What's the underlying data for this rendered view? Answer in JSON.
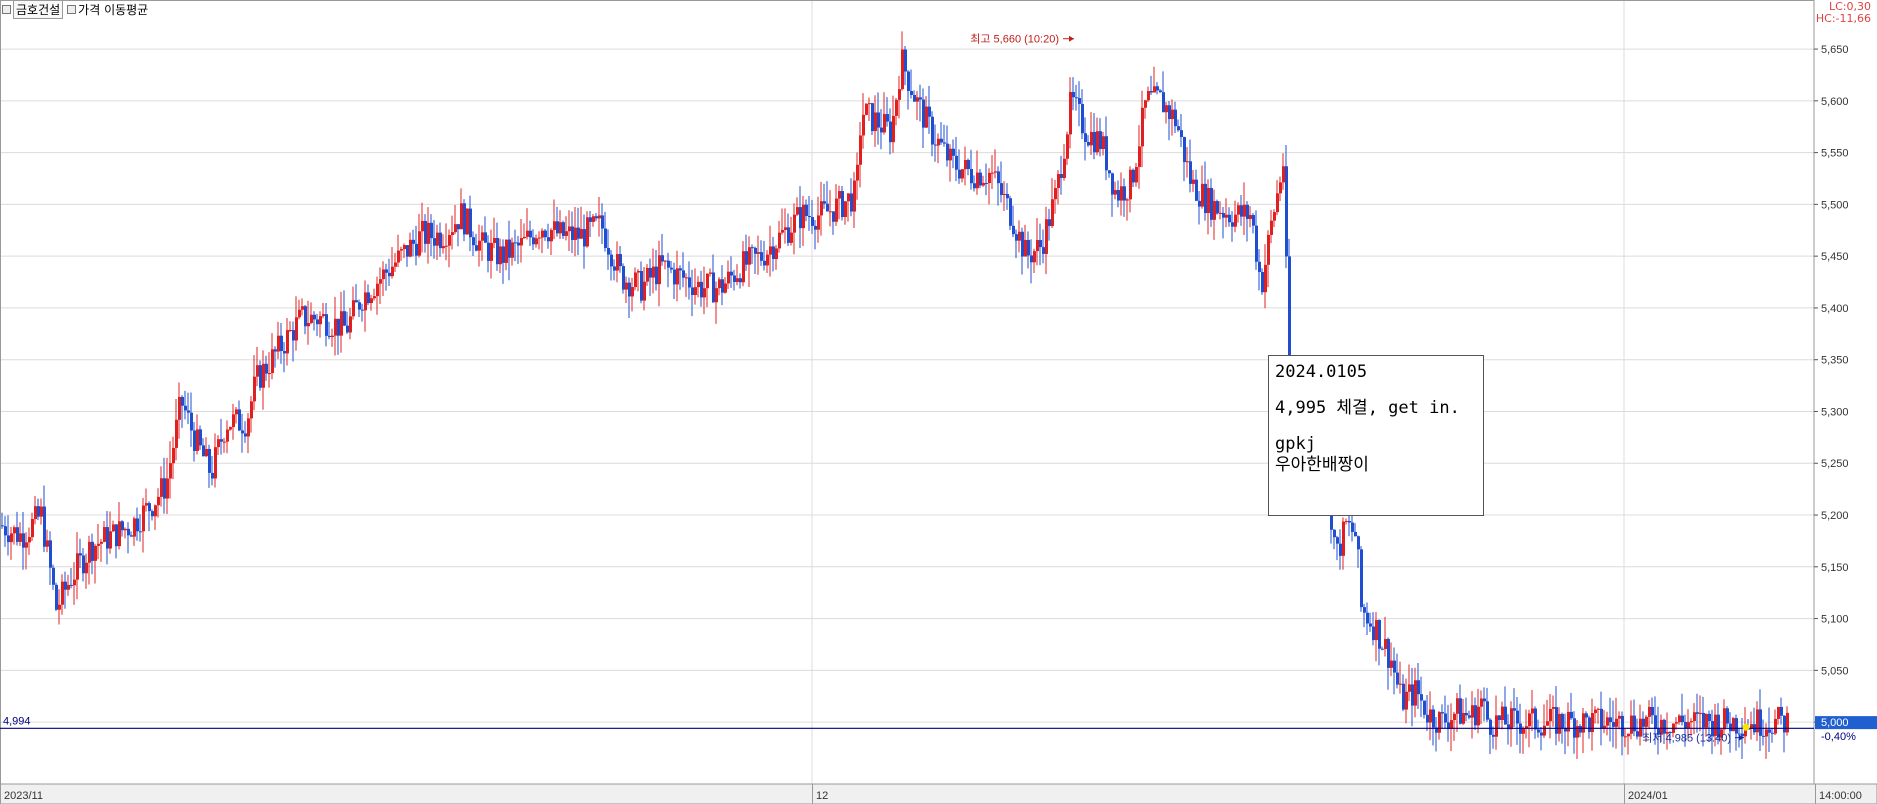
{
  "header": {
    "stock_name": "금호건설",
    "indicator_label": "가격 이동평균",
    "lc_label": "LC:0,30",
    "hc_label": "HC:-11,66"
  },
  "note": {
    "line1": "2024.0105",
    "line2": "4,995 체결, get in.",
    "line3": "gpkj",
    "line4": "우아한배짱이"
  },
  "colors": {
    "up": "#e02020",
    "down": "#1f4fd0",
    "baseline": "#000080",
    "grid": "#dcdcdc"
  },
  "chart_data": {
    "type": "bar",
    "subtype": "intraday price chart (up/down ticks)",
    "ylim": [
      4975,
      5680
    ],
    "y_ticks": [
      "5,000",
      "5,050",
      "5,100",
      "5,150",
      "5,200",
      "5,250",
      "5,300",
      "5,350",
      "5,400",
      "5,450",
      "5,500",
      "5,550",
      "5,600",
      "5,650"
    ],
    "y_tick_values": [
      5000,
      5050,
      5100,
      5150,
      5200,
      5250,
      5300,
      5350,
      5400,
      5450,
      5500,
      5550,
      5600,
      5650
    ],
    "x_ticks": [
      "2023/11",
      "12",
      "2024/01",
      "14:00:00"
    ],
    "high": {
      "value": 5660,
      "label": "최고 5,660 (10:20)"
    },
    "low": {
      "value": 4985,
      "label": "최저 4,985 (13:40)"
    },
    "left_value_label": "4,994",
    "current_price_label": "5,000",
    "change_label": "-0,40%",
    "baseline_value": 4994,
    "approx_price_path": [
      [
        0,
        5190
      ],
      [
        20,
        5180
      ],
      [
        40,
        5200
      ],
      [
        55,
        5110
      ],
      [
        70,
        5140
      ],
      [
        90,
        5170
      ],
      [
        110,
        5180
      ],
      [
        130,
        5190
      ],
      [
        150,
        5210
      ],
      [
        165,
        5230
      ],
      [
        180,
        5310
      ],
      [
        195,
        5270
      ],
      [
        210,
        5240
      ],
      [
        225,
        5290
      ],
      [
        245,
        5290
      ],
      [
        255,
        5330
      ],
      [
        270,
        5350
      ],
      [
        285,
        5370
      ],
      [
        300,
        5390
      ],
      [
        320,
        5390
      ],
      [
        345,
        5380
      ],
      [
        360,
        5410
      ],
      [
        380,
        5430
      ],
      [
        400,
        5450
      ],
      [
        420,
        5470
      ],
      [
        440,
        5470
      ],
      [
        460,
        5490
      ],
      [
        480,
        5460
      ],
      [
        500,
        5450
      ],
      [
        520,
        5460
      ],
      [
        540,
        5480
      ],
      [
        560,
        5470
      ],
      [
        580,
        5470
      ],
      [
        600,
        5480
      ],
      [
        620,
        5430
      ],
      [
        640,
        5420
      ],
      [
        660,
        5440
      ],
      [
        680,
        5430
      ],
      [
        700,
        5420
      ],
      [
        720,
        5420
      ],
      [
        740,
        5440
      ],
      [
        760,
        5450
      ],
      [
        780,
        5470
      ],
      [
        800,
        5490
      ],
      [
        820,
        5490
      ],
      [
        840,
        5500
      ],
      [
        855,
        5510
      ],
      [
        860,
        5590
      ],
      [
        875,
        5580
      ],
      [
        890,
        5570
      ],
      [
        900,
        5640
      ],
      [
        915,
        5600
      ],
      [
        930,
        5570
      ],
      [
        950,
        5540
      ],
      [
        970,
        5530
      ],
      [
        990,
        5530
      ],
      [
        1010,
        5490
      ],
      [
        1025,
        5450
      ],
      [
        1040,
        5460
      ],
      [
        1055,
        5510
      ],
      [
        1070,
        5600
      ],
      [
        1085,
        5570
      ],
      [
        1100,
        5560
      ],
      [
        1115,
        5510
      ],
      [
        1130,
        5520
      ],
      [
        1145,
        5600
      ],
      [
        1160,
        5600
      ],
      [
        1175,
        5580
      ],
      [
        1190,
        5520
      ],
      [
        1210,
        5500
      ],
      [
        1230,
        5490
      ],
      [
        1250,
        5490
      ],
      [
        1260,
        5420
      ],
      [
        1270,
        5480
      ],
      [
        1282,
        5540
      ],
      [
        1288,
        5330
      ],
      [
        1300,
        5310
      ],
      [
        1315,
        5270
      ],
      [
        1325,
        5240
      ],
      [
        1335,
        5160
      ],
      [
        1345,
        5190
      ],
      [
        1355,
        5180
      ],
      [
        1360,
        5110
      ],
      [
        1375,
        5090
      ],
      [
        1390,
        5060
      ],
      [
        1400,
        5020
      ],
      [
        1415,
        5030
      ],
      [
        1425,
        5010
      ],
      [
        1440,
        5000
      ],
      [
        1455,
        5010
      ],
      [
        1470,
        5005
      ],
      [
        1480,
        5020
      ],
      [
        1487,
        5000
      ]
    ]
  }
}
